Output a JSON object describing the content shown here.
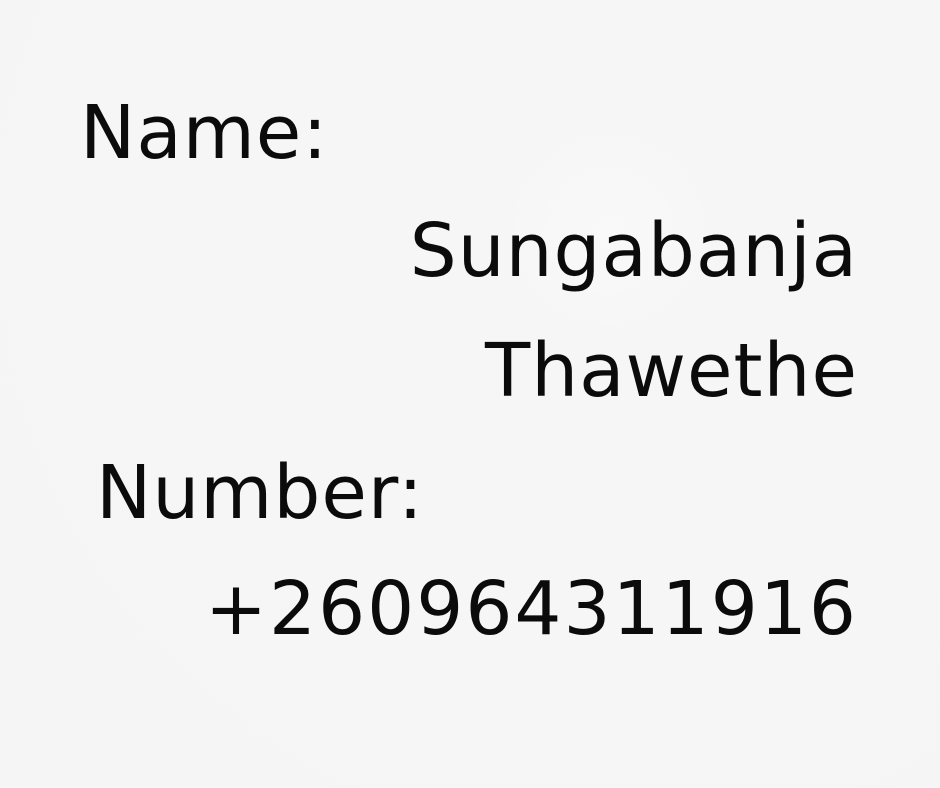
{
  "name": {
    "label": "Name:",
    "first": "Sungabanja",
    "last": "Thawethe"
  },
  "number": {
    "label": "Number:",
    "value": "+260964311916"
  },
  "colors": {
    "background": "#f6f6f6",
    "text": "#0b0b0b"
  }
}
